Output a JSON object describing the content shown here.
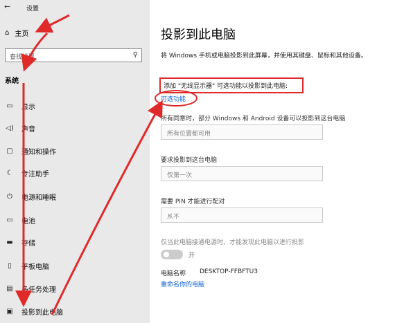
{
  "app": {
    "title": "设置",
    "back_icon": "back-arrow-icon"
  },
  "sidebar": {
    "home": "主页",
    "search_placeholder": "查找设置",
    "section": "系统",
    "items": [
      {
        "icon": "display-icon",
        "glyph": "▭",
        "label": "显示"
      },
      {
        "icon": "sound-icon",
        "glyph": "🔈",
        "label": "声音"
      },
      {
        "icon": "notification-icon",
        "glyph": "▢",
        "label": "通知和操作"
      },
      {
        "icon": "focus-assist-icon",
        "glyph": "☾",
        "label": "专注助手"
      },
      {
        "icon": "power-icon",
        "glyph": "⏻",
        "label": "电源和睡眠"
      },
      {
        "icon": "battery-icon",
        "glyph": "▭",
        "label": "电池"
      },
      {
        "icon": "storage-icon",
        "glyph": "▬",
        "label": "存储"
      },
      {
        "icon": "tablet-icon",
        "glyph": "▯",
        "label": "平板电脑"
      },
      {
        "icon": "multitask-icon",
        "glyph": "▤",
        "label": "多任务处理"
      },
      {
        "icon": "project-icon",
        "glyph": "▣",
        "label": "投影到此电脑"
      }
    ]
  },
  "main": {
    "title": "投影到此电脑",
    "description": "将 Windows 手机或电脑投影到此屏幕，并使用其键盘、鼠标和其他设备。",
    "add_display_text": "添加 \"无线显示器\" 可选功能以投影到此电脑:",
    "optional_features_link": "可选功能",
    "setting1_label": "一些 Windows 和 Android 设备可以投影到这台电脑",
    "setting1_label_prefix": "所有同意时，部分 Windows 和 Android 设备可以投影到这台电脑",
    "setting1_value": "所有位置都可用",
    "setting2_label": "要求投影到这台电脑",
    "setting2_value": "仅第一次",
    "setting3_label": "需要 PIN 才能进行配对",
    "setting3_value": "从不",
    "power_note": "仅当此电脑接通电源时，才能发现此电脑以进行投影",
    "toggle_label": "开",
    "pc_name_label": "电脑名称",
    "pc_name_value": "DESKTOP-FFBFTU3",
    "rename_link": "重命名你的电脑"
  },
  "colors": {
    "annotation": "#e02a2a",
    "link": "#0a5fd6",
    "sidebar_bg": "#e9e9ea"
  }
}
